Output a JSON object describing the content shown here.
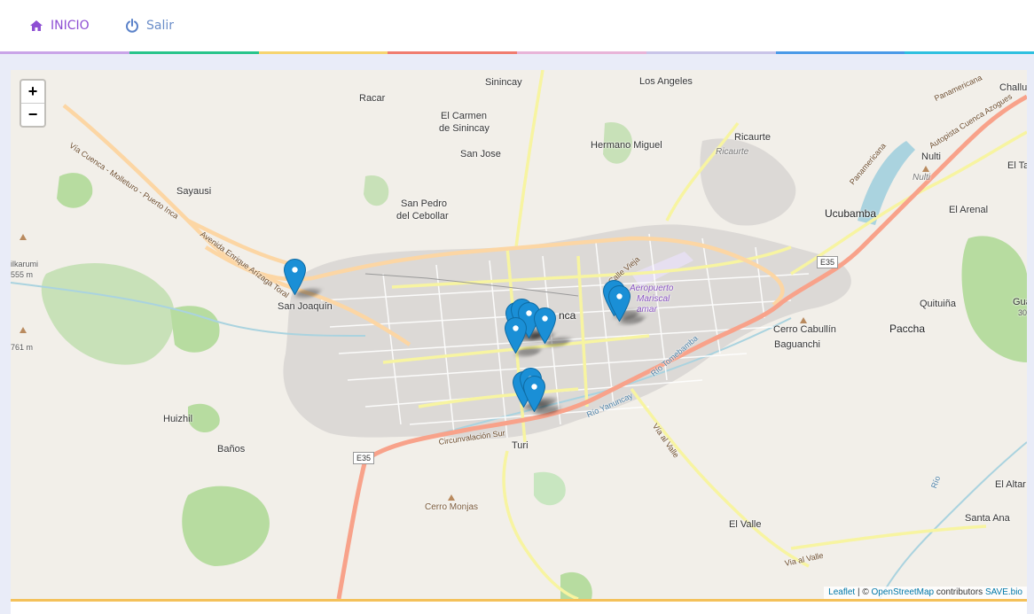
{
  "nav": {
    "inicio_label": "INICIO",
    "salir_label": "Salir",
    "inicio_icon": "home-icon",
    "salir_icon": "power-icon"
  },
  "stripe_colors": [
    "#c9a4e8",
    "#28c48b",
    "#f6d46f",
    "#f07c6f",
    "#e8b4d8",
    "#c9c4e8",
    "#4a9ae8",
    "#2ec0e0"
  ],
  "map": {
    "zoom_in": "+",
    "zoom_out": "−",
    "attribution": {
      "leaflet": "Leaflet",
      "separator": " | © ",
      "osm": "OpenStreetMap",
      "contributors": " contributors ",
      "save": "SAVE.bio"
    },
    "places": {
      "sinincay": "Sinincay",
      "los_angeles": "Los Angeles",
      "chaullabamba": "Challu",
      "racar": "Racar",
      "el_carmen": "El Carmen",
      "de_sinincay": "de Sinincay",
      "hermano_miguel": "Hermano Miguel",
      "ricaurte": "Ricaurte",
      "ricaurte_small": "Ricaurte",
      "nulti": "Nulti",
      "nulti_small": "Nulti",
      "el_ta": "El Ta",
      "san_jose": "San Jose",
      "sayausi": "Sayausi",
      "san_pedro": "San Pedro",
      "del_cebollar": "del Cebollar",
      "ucubamba": "Ucubamba",
      "el_arenal": "El Arenal",
      "ilkarumi": "ilkarumi",
      "ilkarumi_elev": "555 m",
      "san_joaquin": "San Joaquín",
      "cuenca": "nca",
      "cerro_cabullin": "Cerro Cabullín",
      "baguanchi": "Baguanchi",
      "quituina": "Quituiña",
      "paccha": "Paccha",
      "guagu": "Guagu",
      "guagu_elev": "30",
      "elev_761": "761 m",
      "huizhil": "Huizhil",
      "banos": "Baños",
      "turi": "Turi",
      "el_altar": "El Altar",
      "cerro_monjas": "Cerro Monjas",
      "el_valle": "El Valle",
      "santa_ana": "Santa Ana",
      "airport_1": "Aeropuerto",
      "airport_2": "Mariscal",
      "airport_3": "amar"
    },
    "roads": {
      "via_cuenca": "Vía Cuenca - Molleturo - Puerto Inca",
      "av_enrique": "Avenida Enrique Arízaga Toral",
      "calle_vieja": "Calle Vieja",
      "circunvalacion": "Circunvalación Sur",
      "rio_yanuncay": "Río Yanuncay",
      "rio_tomebamba": "Río Tomebamba",
      "via_al_valle": "Vía al Valle",
      "via_al_valle2": "Via al Valle",
      "panamericana": "Panamericana",
      "panamericana2": "Panamericana",
      "autopista": "Autopista Cuenca Azogues",
      "rio": "Río",
      "e35_a": "E35",
      "e35_b": "E35"
    },
    "markers": [
      {
        "name": "marker-san-joaquin"
      },
      {
        "name": "marker-centro-1"
      },
      {
        "name": "marker-centro-2"
      },
      {
        "name": "marker-centro-3"
      },
      {
        "name": "marker-centro-4"
      },
      {
        "name": "marker-centro-5"
      },
      {
        "name": "marker-airport-1"
      },
      {
        "name": "marker-airport-2"
      },
      {
        "name": "marker-south-1"
      },
      {
        "name": "marker-south-2"
      },
      {
        "name": "marker-south-3"
      }
    ],
    "marker_color": "#1a8fd6"
  }
}
